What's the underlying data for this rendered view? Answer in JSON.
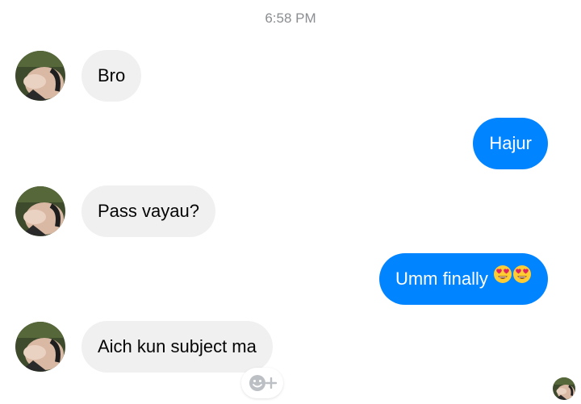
{
  "timestamp": "6:58 PM",
  "messages": [
    {
      "direction": "incoming",
      "text": "Bro"
    },
    {
      "direction": "outgoing",
      "text": "Hajur"
    },
    {
      "direction": "incoming",
      "text": "Pass vayau?"
    },
    {
      "direction": "outgoing",
      "text": "Umm finally",
      "emoji": [
        "heart-eyes-emoji",
        "heart-eyes-emoji"
      ]
    },
    {
      "direction": "incoming",
      "text": "Aich kun subject ma"
    }
  ],
  "icons": {
    "reaction": "add-reaction-icon",
    "read_receipt": "read-receipt-avatar"
  },
  "colors": {
    "outgoing_bubble": "#0084ff",
    "incoming_bubble": "#f0f0f0",
    "timestamp": "#8a8d91"
  }
}
